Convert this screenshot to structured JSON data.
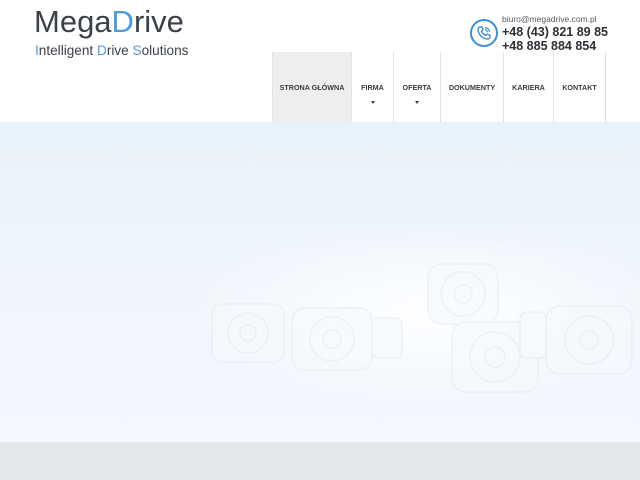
{
  "logo": {
    "title_part1": "Mega",
    "title_part2": "D",
    "title_part3": "rive",
    "subtitle_parts": [
      "I",
      "ntelligent ",
      "D",
      "rive ",
      "S",
      "olutions"
    ]
  },
  "contact": {
    "email": "biuro@megadrive.com.pl",
    "phone1": "+48 (43) 821 89 85",
    "phone2": "+48 885 884 854",
    "icon": "phone-icon"
  },
  "nav": {
    "items": [
      {
        "label": "STRONA GŁÓWNA"
      },
      {
        "label": "FIRMA"
      },
      {
        "label": "OFERTA"
      },
      {
        "label": "DOKUMENTY"
      },
      {
        "label": "KARIERA"
      },
      {
        "label": "KONTAKT"
      }
    ]
  },
  "colors": {
    "accent": "#4f9bd9",
    "text_dark": "#3c4148",
    "nav_active_bg": "#eeeeee",
    "hero_bg": "#eef4fa",
    "footer_strip": "#e5e7e8"
  }
}
